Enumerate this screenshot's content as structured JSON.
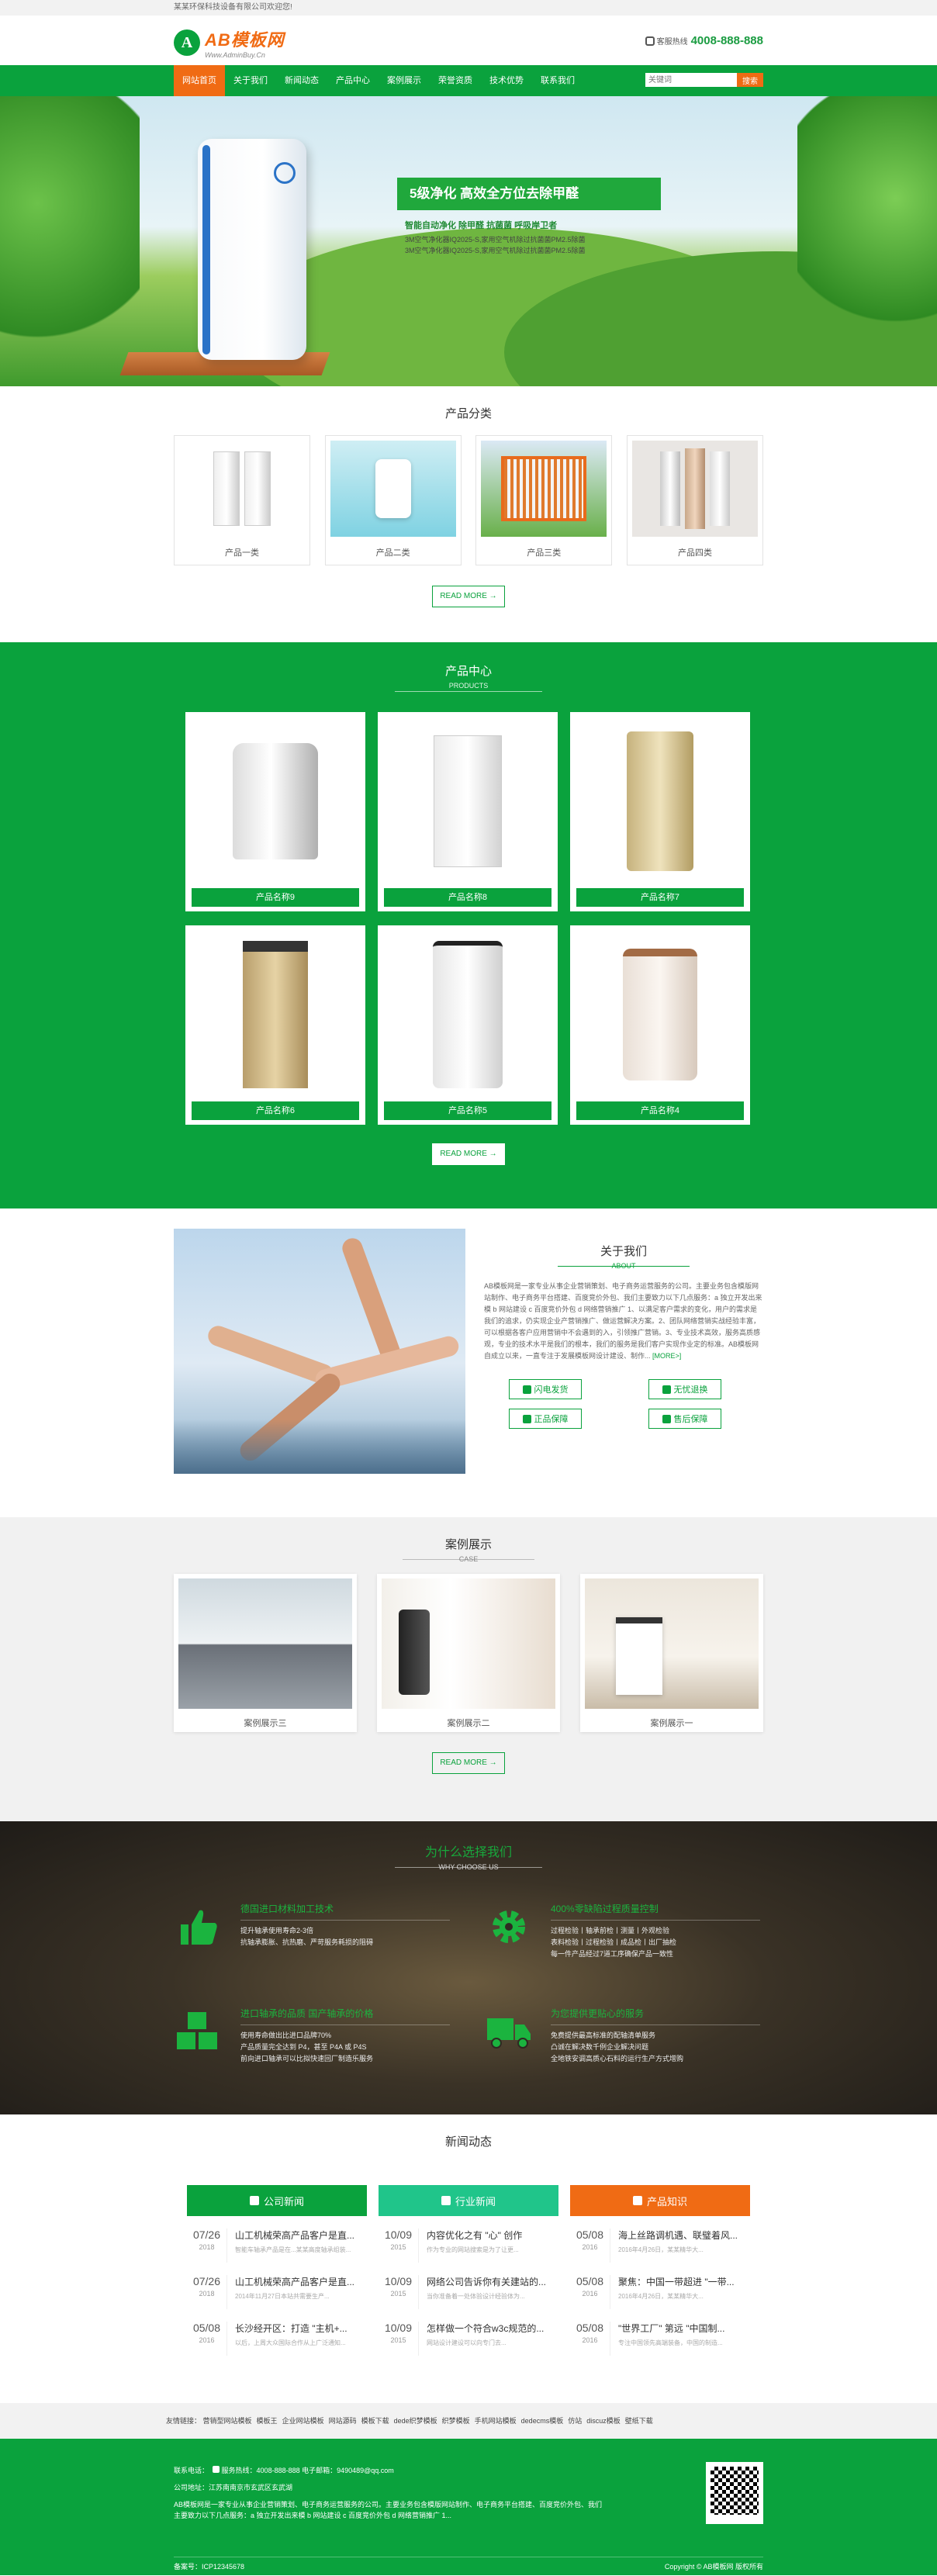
{
  "topbar": {
    "welcome": "某某环保科技设备有限公司欢迎您!"
  },
  "header": {
    "logo_mark": "A",
    "logo_name": "AB模板网",
    "logo_sub": "Www.AdminBuy.Cn",
    "hotline_label": "客服热线",
    "hotline_number": "4008-888-888"
  },
  "nav": {
    "items": [
      "网站首页",
      "关于我们",
      "新闻动态",
      "产品中心",
      "案例展示",
      "荣誉资质",
      "技术优势",
      "联系我们"
    ],
    "search_placeholder": "关键词",
    "search_button": "搜索"
  },
  "banner": {
    "slogan": "5级净化 高效全方位去除甲醛",
    "tagline": "智能自动净化 除甲醛 抗菌菌 呼吸岸卫者",
    "lines": [
      "3M空气净化器IQ2025-S,家用空气机除过抗菌菌PM2.5除菌",
      "3M空气净化器IQ2025-S,家用空气机除过抗菌菌PM2.5除菌"
    ]
  },
  "categories": {
    "title": "产品分类",
    "items": [
      "产品一类",
      "产品二类",
      "产品三类",
      "产品四类"
    ],
    "more": "READ MORE →"
  },
  "products": {
    "title": "产品中心",
    "subtitle": "PRODUCTS",
    "items": [
      "产品名称9",
      "产品名称8",
      "产品名称7",
      "产品名称6",
      "产品名称5",
      "产品名称4"
    ],
    "more": "READ MORE →"
  },
  "about": {
    "title": "关于我们",
    "subtitle": "ABOUT",
    "text": "AB模板网是一家专业从事企业营销策划、电子商务运营服务的公司。主要业务包含模版网站制作、电子商务平台搭建、百度竞价外包、我们主要致力以下几点服务：a 独立开发出来模 b 网站建设 c 百度竞价外包 d 网络营销推广 1、以满足客户需求的变化，用户的需求是我们的追求，仍实现企业产营销推广、做运营解决方案。2、团队网络营销实战经验丰富，可以根据各客户应用营销中不会遇到的入，引领推广营销。3、专业技术高效，服务高质感观，专业的技术水平是我们的根本，我们的服务是我们客户实现作业定的标准。AB模板网自成立以来，一直专注于发展模板网设计建设、制作...",
    "more": "[MORE>]",
    "buttons": [
      "闪电发货",
      "无忧退换",
      "正品保障",
      "售后保障"
    ]
  },
  "cases": {
    "title": "案例展示",
    "subtitle": "CASE",
    "items": [
      "案例展示三",
      "案例展示二",
      "案例展示一"
    ],
    "more": "READ MORE →"
  },
  "why": {
    "title": "为什么选择我们",
    "subtitle": "WHY CHOOSE US",
    "items": [
      {
        "heading": "德国进口材料加工技术",
        "lines": [
          "提升轴承使用寿命2-3倍",
          "抗轴承膨胀、抗热磨、严苛服务耗损的阻碍"
        ]
      },
      {
        "heading": "400%零缺陷过程质量控制",
        "lines": [
          "过程检验丨轴承前检丨测量丨外观检验",
          "表料检验丨过程检验丨成品检丨出厂抽检",
          "每一件产品经过7道工序确保产品一致性"
        ]
      },
      {
        "heading": "进口轴承的品质 国产轴承的价格",
        "lines": [
          "使用寿命做出比进口品牌70%",
          "产品质量完全达到 P4，甚至 P4A 或 P4S",
          "前向进口轴承可以比拟快速回厂制造乐服务"
        ]
      },
      {
        "heading": "为您提供更贴心的服务",
        "lines": [
          "免费提供最高标准的配轴清单服务",
          "凸诚在解决数千例企业解决问题",
          "全地铁安调高质心石料的运行生产方式增购"
        ]
      }
    ]
  },
  "news": {
    "title": "新闻动态",
    "columns": [
      {
        "heading": "公司新闻",
        "color": "#0aa23d",
        "items": [
          {
            "date": "07/26",
            "year": "2018",
            "title": "山工机械荣高产品客户是直...",
            "summary": "智能车轴承产品是在...某某高度轴承组装..."
          },
          {
            "date": "07/26",
            "year": "2018",
            "title": "山工机械荣高产品客户是直...",
            "summary": "2014年11月27日本站共需要生产..."
          },
          {
            "date": "05/08",
            "year": "2016",
            "title": "长沙经开区：打造 \"主机+...",
            "summary": "以后，上周大众国际合作从上广泛通知..."
          }
        ]
      },
      {
        "heading": "行业新闻",
        "color": "#20c58a",
        "items": [
          {
            "date": "10/09",
            "year": "2015",
            "title": "内容优化之有 \"心\" 创作",
            "summary": "作为专业的网站搜索是为了让更..."
          },
          {
            "date": "10/09",
            "year": "2015",
            "title": "网络公司告诉你有关建站的...",
            "summary": "当你准备着一处体验设计经验体为..."
          },
          {
            "date": "10/09",
            "year": "2015",
            "title": "怎样做一个符合w3c规范的...",
            "summary": "网站设计建设可以向专门去..."
          }
        ]
      },
      {
        "heading": "产品知识",
        "color": "#f06b14",
        "items": [
          {
            "date": "05/08",
            "year": "2016",
            "title": "海上丝路调机遇、联璧着风...",
            "summary": "2016年4月26日，某某精华大..."
          },
          {
            "date": "05/08",
            "year": "2016",
            "title": "聚焦：中国一带超进 \"一带...",
            "summary": "2016年4月26日，某某精华大..."
          },
          {
            "date": "05/08",
            "year": "2016",
            "title": "\"世界工厂\" 第远 \"中国制...",
            "summary": "专注中国领先高端装备，中国的制造..."
          }
        ]
      }
    ]
  },
  "links": {
    "label": "友情链接：",
    "items": [
      "营销型网站模板",
      "模板王",
      "企业网站模板",
      "网站源码",
      "模板下载",
      "dede织梦模板",
      "织梦模板",
      "手机网站模板",
      "dedecms模板",
      "仿站",
      "discuz模板",
      "壁纸下载"
    ]
  },
  "footer": {
    "address_label": "联系电话：",
    "service": "服务热线：4008-888-888 电子邮箱：9490489@qq.com",
    "company": "公司地址：江苏南南京市玄武区玄武湖",
    "desc1": "AB模板网是一家专业从事企业营销策划、电子商务运营服务的公司。主要业务包含模版网站制作、电子商务平台搭建、百度竞价外包、我们",
    "desc2": "主要致力以下几点服务：a 独立开发出来模 b 网站建设 c 百度竞价外包 d 网络营销推广 1...",
    "icp": "备案号：ICP12345678",
    "copyright": "Copyright © AB模板网 版权所有"
  }
}
